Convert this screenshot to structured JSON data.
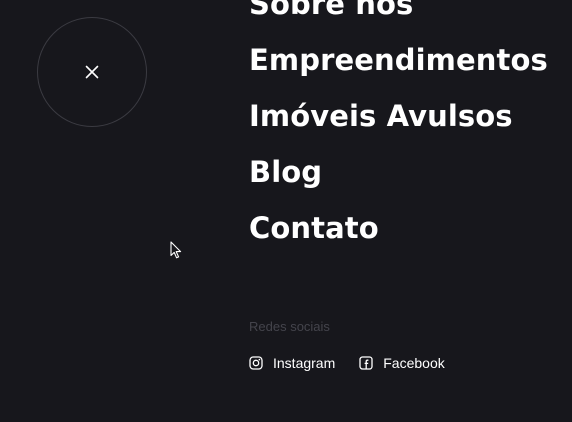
{
  "close_button": {
    "icon": "close-icon"
  },
  "nav": {
    "items": [
      {
        "label": "Sobre nós"
      },
      {
        "label": "Empreendimentos"
      },
      {
        "label": "Imóveis Avulsos"
      },
      {
        "label": "Blog"
      },
      {
        "label": "Contato"
      }
    ]
  },
  "social": {
    "heading": "Redes sociais",
    "links": [
      {
        "label": "Instagram",
        "icon": "instagram-icon"
      },
      {
        "label": "Facebook",
        "icon": "facebook-icon"
      }
    ]
  },
  "colors": {
    "background": "#17171c",
    "text": "#ffffff",
    "muted": "#44444c",
    "circle_border": "#3b3b42"
  }
}
